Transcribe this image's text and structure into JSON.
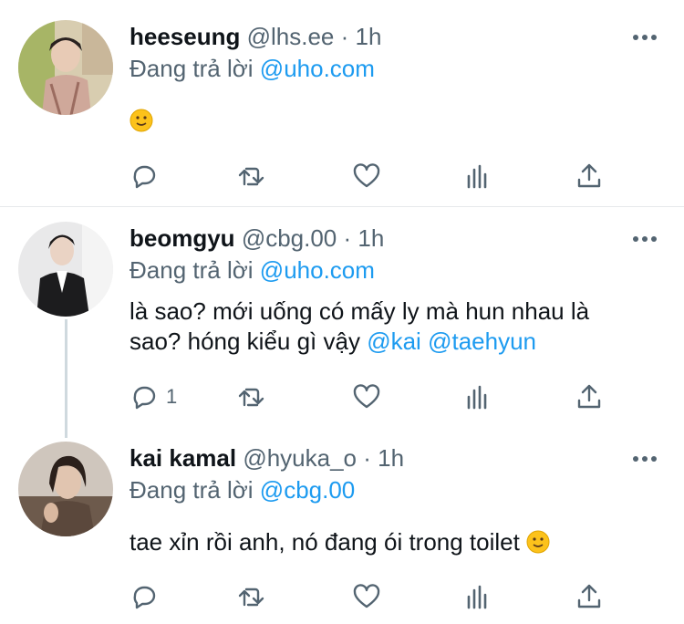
{
  "tweets": [
    {
      "name": "heeseung",
      "handle": "@lhs.ee",
      "dot": "·",
      "time": "1h",
      "replying_prefix": "Đang trả lời",
      "replying_to": "@uho.com",
      "text": "",
      "reply_count": "",
      "avatar_icon": "avatar-photo"
    },
    {
      "name": "beomgyu",
      "handle": "@cbg.00",
      "dot": "·",
      "time": "1h",
      "replying_prefix": "Đang trả lời",
      "replying_to": "@uho.com",
      "text_line1": "là sao? mới uống có mấy ly mà hun nhau là",
      "text_line2_prefix": "sao? hóng kiểu gì vậy",
      "mention1": "@kai",
      "mention2": "@taehyun",
      "reply_count": "1",
      "avatar_icon": "avatar-photo"
    },
    {
      "name": "kai kamal",
      "handle": "@hyuka_o",
      "dot": "·",
      "time": "1h",
      "replying_prefix": "Đang trả lời",
      "replying_to": "@cbg.00",
      "text": "tae xỉn rồi anh, nó đang ói trong toilet",
      "reply_count": "",
      "avatar_icon": "avatar-photo"
    }
  ],
  "icons": {
    "reply": "reply-icon",
    "retweet": "retweet-icon",
    "like": "heart-icon",
    "stats": "stats-icon",
    "share": "share-icon",
    "more": "more-icon",
    "emoji": "slightly-smiling-face-emoji"
  },
  "colors": {
    "text": "#0f1419",
    "secondary": "#536471",
    "mention": "#1d9bf0",
    "divider": "#e6e9eb",
    "thread_line": "#cfd9de"
  }
}
